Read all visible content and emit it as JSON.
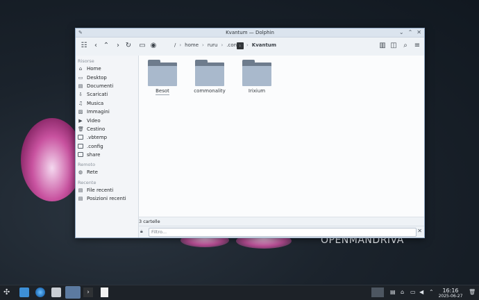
{
  "window": {
    "title": "Kvantum — Dolphin",
    "pin_icon": "pin-icon",
    "controls": [
      "⌄",
      "⌃",
      "✕"
    ]
  },
  "toolbar": {
    "breadcrumb": [
      "/",
      "home",
      "ruru",
      ".config",
      "Kvantum"
    ]
  },
  "sidebar": {
    "sections": [
      {
        "title": "Risorse",
        "items": [
          {
            "label": "Home",
            "icon": "home-icon"
          },
          {
            "label": "Desktop",
            "icon": "desktop-icon"
          },
          {
            "label": "Documenti",
            "icon": "documents-icon"
          },
          {
            "label": "Scaricati",
            "icon": "downloads-icon"
          },
          {
            "label": "Musica",
            "icon": "music-icon"
          },
          {
            "label": "Immagini",
            "icon": "pictures-icon"
          },
          {
            "label": "Video",
            "icon": "video-icon"
          },
          {
            "label": "Cestino",
            "icon": "trash-icon"
          },
          {
            "label": ".vbtemp",
            "icon": "folder-icon"
          },
          {
            "label": ".config",
            "icon": "folder-icon"
          },
          {
            "label": "share",
            "icon": "folder-icon"
          }
        ]
      },
      {
        "title": "Remoto",
        "items": [
          {
            "label": "Rete",
            "icon": "network-icon"
          }
        ]
      },
      {
        "title": "Recente",
        "items": [
          {
            "label": "File recenti",
            "icon": "recent-files-icon"
          },
          {
            "label": "Posizioni recenti",
            "icon": "recent-locations-icon"
          }
        ]
      }
    ]
  },
  "folders": [
    "Besot",
    "commonality",
    "Irixium"
  ],
  "status": {
    "count": "3 cartelle"
  },
  "filter": {
    "placeholder": "Filtro..."
  },
  "brand": "OPENMANDRIVA",
  "clock": {
    "time": "16:16",
    "date": "2025-06-27"
  }
}
